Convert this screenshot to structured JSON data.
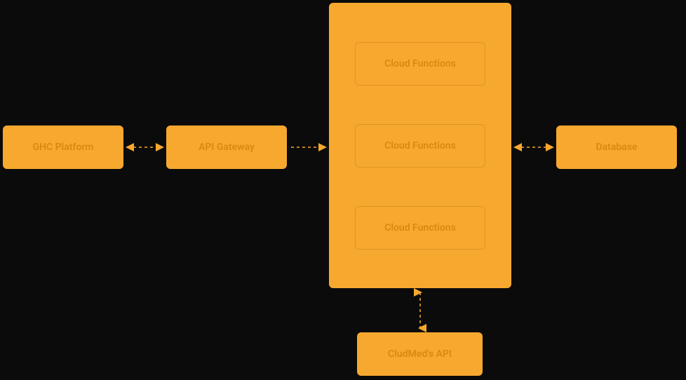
{
  "diagram": {
    "nodes": {
      "ghc_platform": "GHC Platform",
      "api_gateway": "API Gateway",
      "cloud_functions_1": "Cloud Functions",
      "cloud_functions_2": "Cloud Functions",
      "cloud_functions_3": "Cloud Functions",
      "database": "Database",
      "cludmed_api": "CludMed's API"
    },
    "colors": {
      "box_fill": "#f7a82f",
      "inner_border": "#e09522",
      "text": "#d88a10",
      "arrow": "#f7a82f",
      "background": "#0b0b0b"
    },
    "connectors": [
      {
        "from": "ghc_platform",
        "to": "api_gateway",
        "bidirectional": true
      },
      {
        "from": "api_gateway",
        "to": "cloud_functions_container",
        "bidirectional": false
      },
      {
        "from": "cloud_functions_container",
        "to": "database",
        "bidirectional": true
      },
      {
        "from": "cloud_functions_container",
        "to": "cludmed_api",
        "bidirectional": true
      }
    ]
  }
}
